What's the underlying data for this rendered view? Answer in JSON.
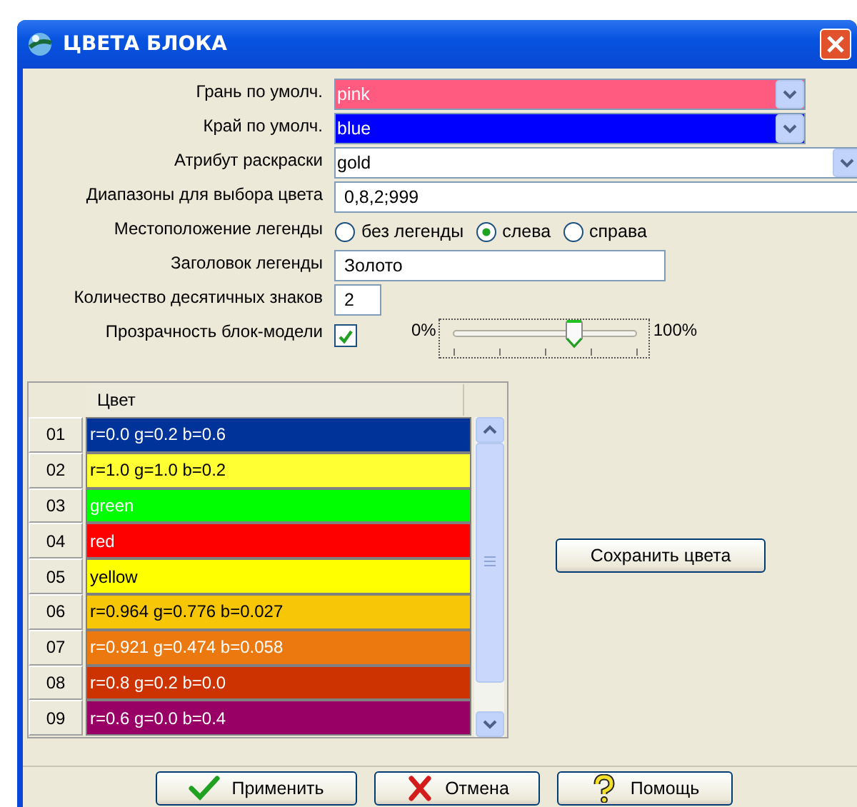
{
  "window": {
    "title": "ЦВЕТА БЛОКА"
  },
  "fields": [
    {
      "kind": "combo",
      "label": "Грань по умолч.",
      "value": "pink",
      "color": "#ff5a80"
    },
    {
      "kind": "combo",
      "label": "Край по умолч.",
      "value": "blue",
      "color": "#0000ff"
    },
    {
      "kind": "combo",
      "label": "Атрибут раскраски",
      "value": "gold",
      "color": "#ffffff"
    },
    {
      "kind": "text",
      "label": "Диапазоны для выбора цвета",
      "value": "0,8,2;999"
    },
    {
      "kind": "radio",
      "label": "Местоположение легенды",
      "options": [
        {
          "label": "без легенды",
          "selected": false
        },
        {
          "label": "слева",
          "selected": true
        },
        {
          "label": "справа",
          "selected": false
        }
      ]
    },
    {
      "kind": "text",
      "label": "Заголовок легенды",
      "value": "Золото"
    },
    {
      "kind": "text",
      "label": "Количество десятичных знаков",
      "value": "2"
    },
    {
      "kind": "transparency",
      "label": "Прозрачность блок-модели",
      "checked": true,
      "min_label": "0%",
      "max_label": "100%",
      "level": 0.66
    }
  ],
  "grid": {
    "columns": [
      "Цвет"
    ],
    "rows": [
      {
        "number": "01",
        "text": "r=0.0 g=0.2 b=0.6",
        "color": "#003399"
      },
      {
        "number": "02",
        "text": "r=1.0 g=1.0 b=0.2",
        "color": "#ffff33"
      },
      {
        "number": "03",
        "text": "green",
        "color": "#00ff00"
      },
      {
        "number": "04",
        "text": "red",
        "color": "#ff0000"
      },
      {
        "number": "05",
        "text": "yellow",
        "color": "#ffff00"
      },
      {
        "number": "06",
        "text": "r=0.964 g=0.776 b=0.027",
        "color": "#f6c607"
      },
      {
        "number": "07",
        "text": "r=0.921 g=0.474 b=0.058",
        "color": "#eb790f"
      },
      {
        "number": "08",
        "text": "r=0.8 g=0.2 b=0.0",
        "color": "#cc3300"
      },
      {
        "number": "09",
        "text": "r=0.6 g=0.0 b=0.4",
        "color": "#990066"
      }
    ]
  },
  "save_button": "Сохранить цвета",
  "buttons": [
    {
      "kind": "apply",
      "label": "Применить"
    },
    {
      "kind": "cancel",
      "label": "Отмена"
    },
    {
      "kind": "help",
      "label": "Помощь"
    }
  ]
}
